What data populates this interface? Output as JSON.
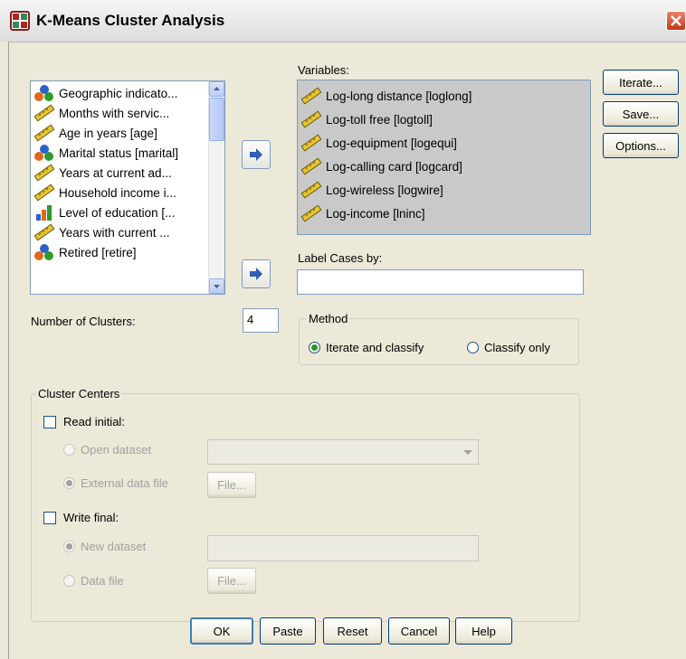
{
  "window": {
    "title": "K-Means Cluster Analysis"
  },
  "source_list": {
    "items": [
      {
        "label": "Geographic indicato...",
        "icon": "nominal-icon"
      },
      {
        "label": "Months with servic...",
        "icon": "scale-ruler-icon"
      },
      {
        "label": "Age in years [age]",
        "icon": "scale-ruler-icon"
      },
      {
        "label": "Marital status [marital]",
        "icon": "nominal-icon"
      },
      {
        "label": "Years at current ad...",
        "icon": "scale-ruler-icon"
      },
      {
        "label": "Household income i...",
        "icon": "scale-ruler-icon"
      },
      {
        "label": "Level of education [...",
        "icon": "ordinal-bars-icon"
      },
      {
        "label": "Years with current ...",
        "icon": "scale-ruler-icon"
      },
      {
        "label": "Retired [retire]",
        "icon": "nominal-icon"
      }
    ]
  },
  "variables": {
    "label": "Variables:",
    "items": [
      "Log-long distance [loglong]",
      "Log-toll free [logtoll]",
      "Log-equipment [logequi]",
      "Log-calling card [logcard]",
      "Log-wireless [logwire]",
      "Log-income [lninc]"
    ]
  },
  "label_cases": {
    "label": "Label Cases by:",
    "value": ""
  },
  "side_buttons": {
    "iterate": "Iterate...",
    "save": "Save...",
    "options": "Options..."
  },
  "num_clusters": {
    "label": "Number of Clusters:",
    "value": "4"
  },
  "method": {
    "legend": "Method",
    "iterate_classify": "Iterate and classify",
    "classify_only": "Classify only",
    "selected": "iterate_classify"
  },
  "cluster_centers": {
    "legend": "Cluster Centers",
    "read_initial": "Read initial:",
    "open_dataset": "Open dataset",
    "external_file": "External data file",
    "file_button": "File...",
    "write_final": "Write final:",
    "new_dataset": "New dataset",
    "data_file": "Data file"
  },
  "footer": {
    "ok": "OK",
    "paste": "Paste",
    "reset": "Reset",
    "cancel": "Cancel",
    "help": "Help"
  },
  "colors": {
    "selected_list_bg": "#c9c9c9",
    "dialog_bg": "#ece9d8",
    "close_red": "#c4381a"
  }
}
